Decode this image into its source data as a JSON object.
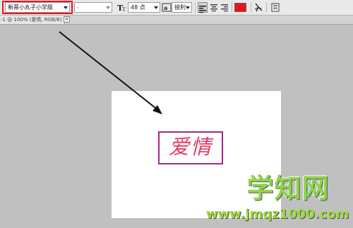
{
  "toolbar": {
    "font_family": "新蒂小丸子小学版",
    "font_style": "-",
    "font_size": "48 点",
    "antialias": "锐利",
    "text_color": "#e8141c"
  },
  "document": {
    "tab_label": "-1 @ 100% (爱情, RGB/8) *",
    "close_glyph": "×"
  },
  "canvas": {
    "text": "爱情",
    "text_color": "#e3385f",
    "frame_color": "#a32a8c"
  },
  "watermark": {
    "title": "学知网",
    "url": "www.jmqz1000.com"
  }
}
